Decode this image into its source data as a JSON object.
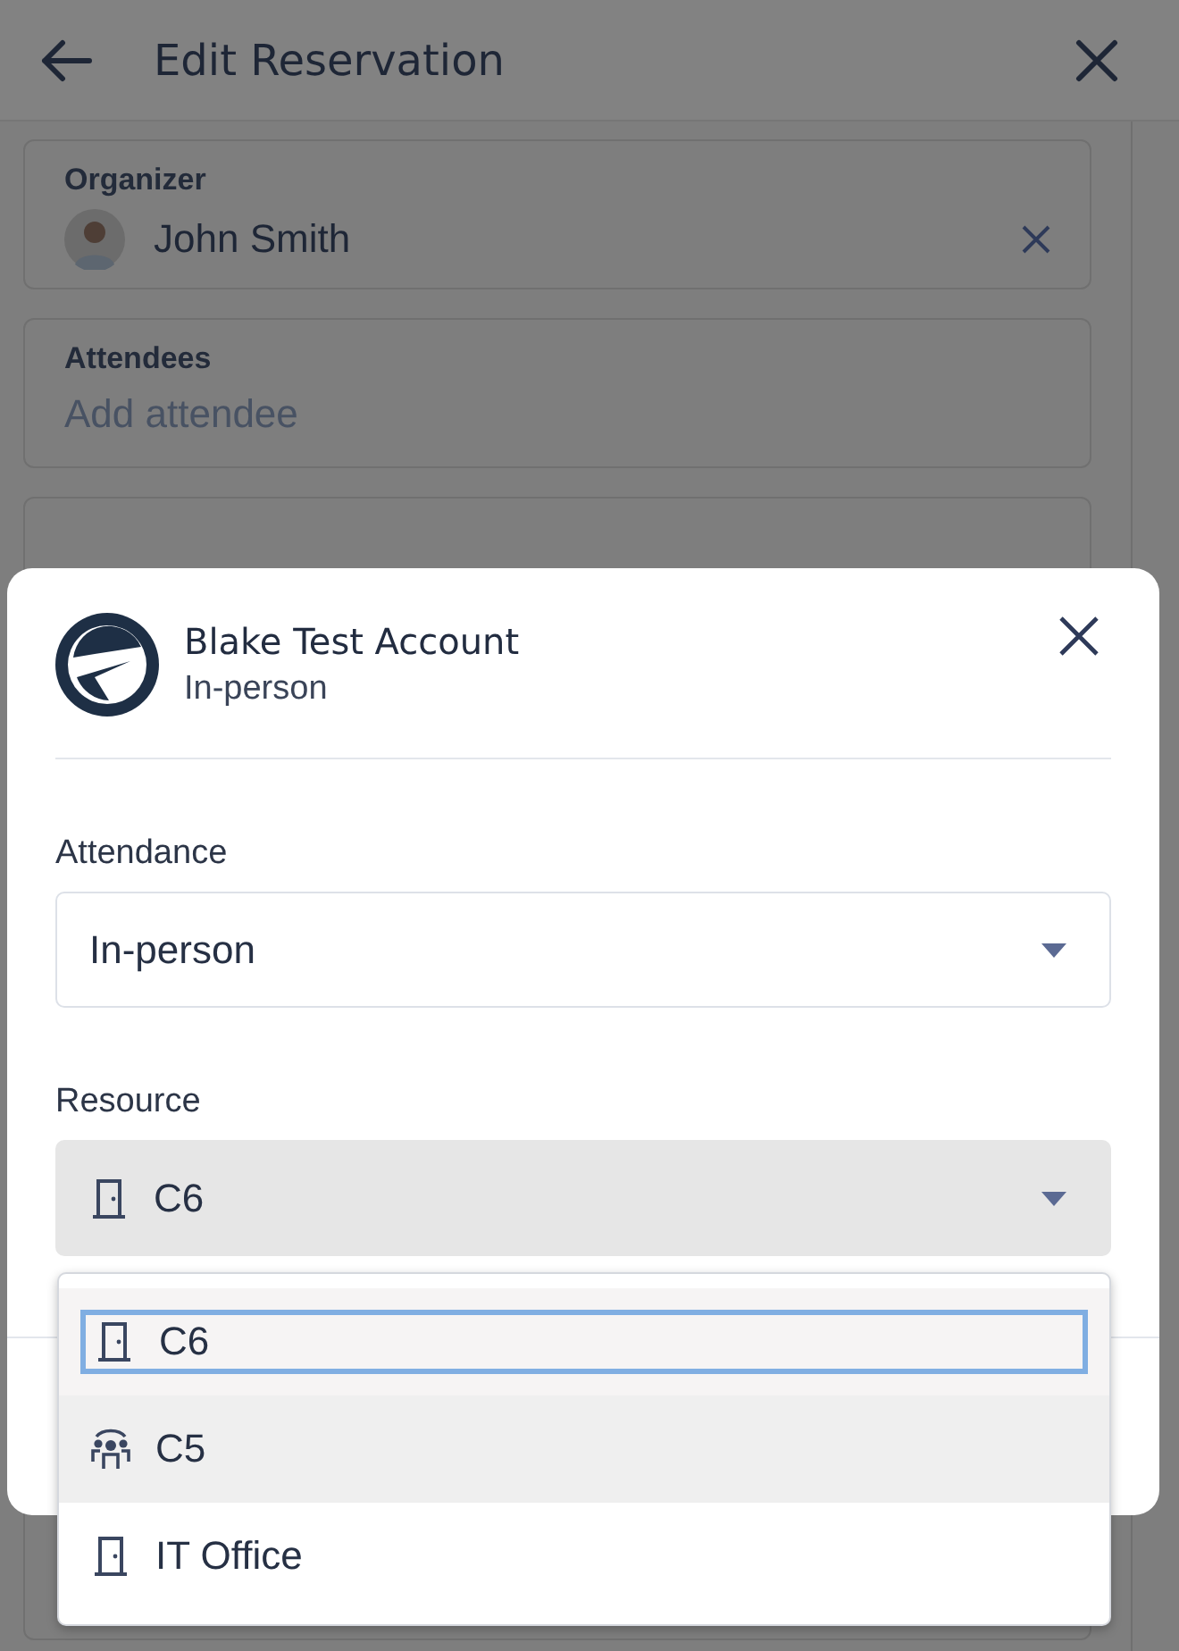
{
  "header": {
    "title": "Edit Reservation"
  },
  "form": {
    "organizer": {
      "label": "Organizer",
      "name": "John Smith"
    },
    "attendees": {
      "label": "Attendees",
      "placeholder": "Add attendee"
    }
  },
  "dialog": {
    "title": "Blake Test Account",
    "subtitle": "In-person",
    "attendance": {
      "label": "Attendance",
      "value": "In-person"
    },
    "resource": {
      "label": "Resource",
      "value": "C6",
      "kind": "room",
      "expanded": true
    },
    "options": [
      {
        "label": "C6",
        "kind": "room",
        "selected": true,
        "hovered": false
      },
      {
        "label": "C5",
        "kind": "group",
        "selected": false,
        "hovered": true
      },
      {
        "label": "IT Office",
        "kind": "room",
        "selected": false,
        "hovered": false
      }
    ]
  }
}
